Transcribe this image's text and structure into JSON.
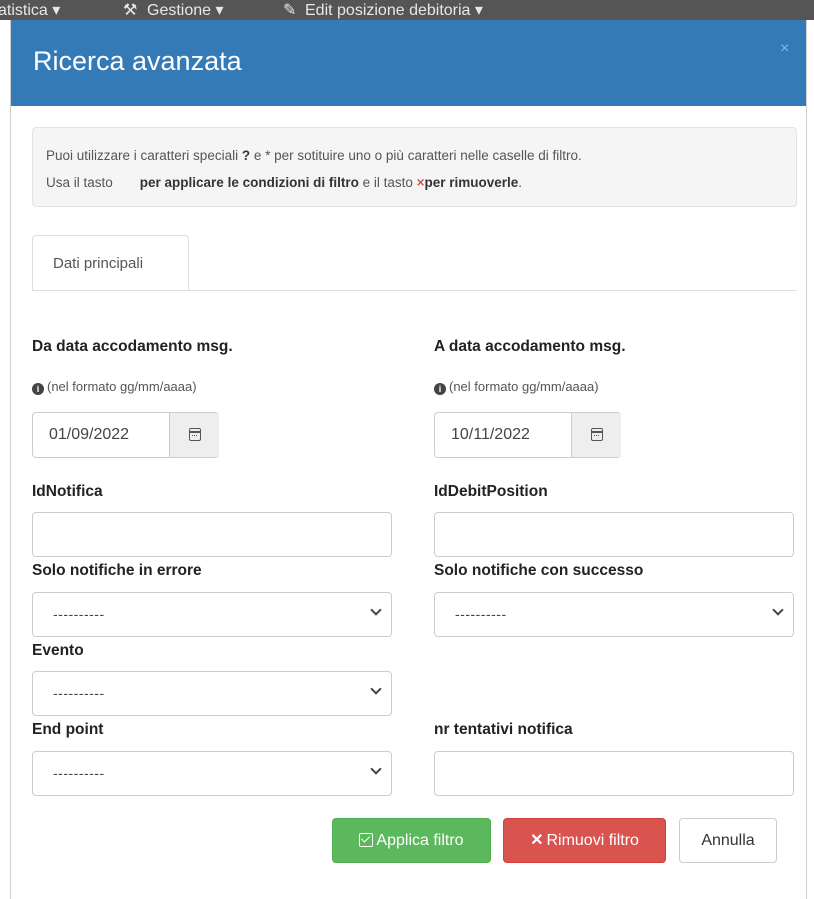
{
  "background_nav": {
    "items": [
      "atistica ▾",
      "Gestione ▾",
      "Edit posizione debitoria ▾"
    ],
    "icons": [
      "wrench-icon",
      "edit-icon"
    ]
  },
  "modal": {
    "title": "Ricerca avanzata",
    "close_glyph": "×",
    "header_color": "#337ab7"
  },
  "info": {
    "line1_pre": "Puoi utilizzare i caratteri speciali ",
    "line1_q": "?",
    "line1_post": " e * per sotituire uno o più caratteri nelle caselle di filtro.",
    "line2_pre": "Usa il tasto",
    "line2_bold1": "per applicare le condizioni di filtro",
    "line2_mid": " e il tasto ",
    "line2_x": "×",
    "line2_bold2": "per rimuoverle",
    "line2_end": "."
  },
  "tabs": [
    {
      "label": "Dati principali",
      "active": true
    }
  ],
  "form": {
    "from_date": {
      "label": "Da data accodamento msg.",
      "hint": "(nel formato gg/mm/aaaa)",
      "value": "01/09/2022"
    },
    "to_date": {
      "label": "A data accodamento msg.",
      "hint": "(nel formato gg/mm/aaaa)",
      "value": "10/11/2022"
    },
    "id_notifica": {
      "label": "IdNotifica",
      "value": ""
    },
    "id_debit_position": {
      "label": "IdDebitPosition",
      "value": ""
    },
    "solo_errore": {
      "label": "Solo notifiche in errore",
      "value": "----------"
    },
    "solo_successo": {
      "label": "Solo notifiche con successo",
      "value": "----------"
    },
    "evento": {
      "label": "Evento",
      "value": "----------"
    },
    "end_point": {
      "label": "End point",
      "value": "----------"
    },
    "nr_tentativi": {
      "label": "nr tentativi notifica",
      "value": ""
    }
  },
  "buttons": {
    "apply": "Applica filtro",
    "remove": "Rimuovi filtro",
    "cancel": "Annulla",
    "apply_color": "#5cb85c",
    "remove_color": "#d9534f"
  }
}
